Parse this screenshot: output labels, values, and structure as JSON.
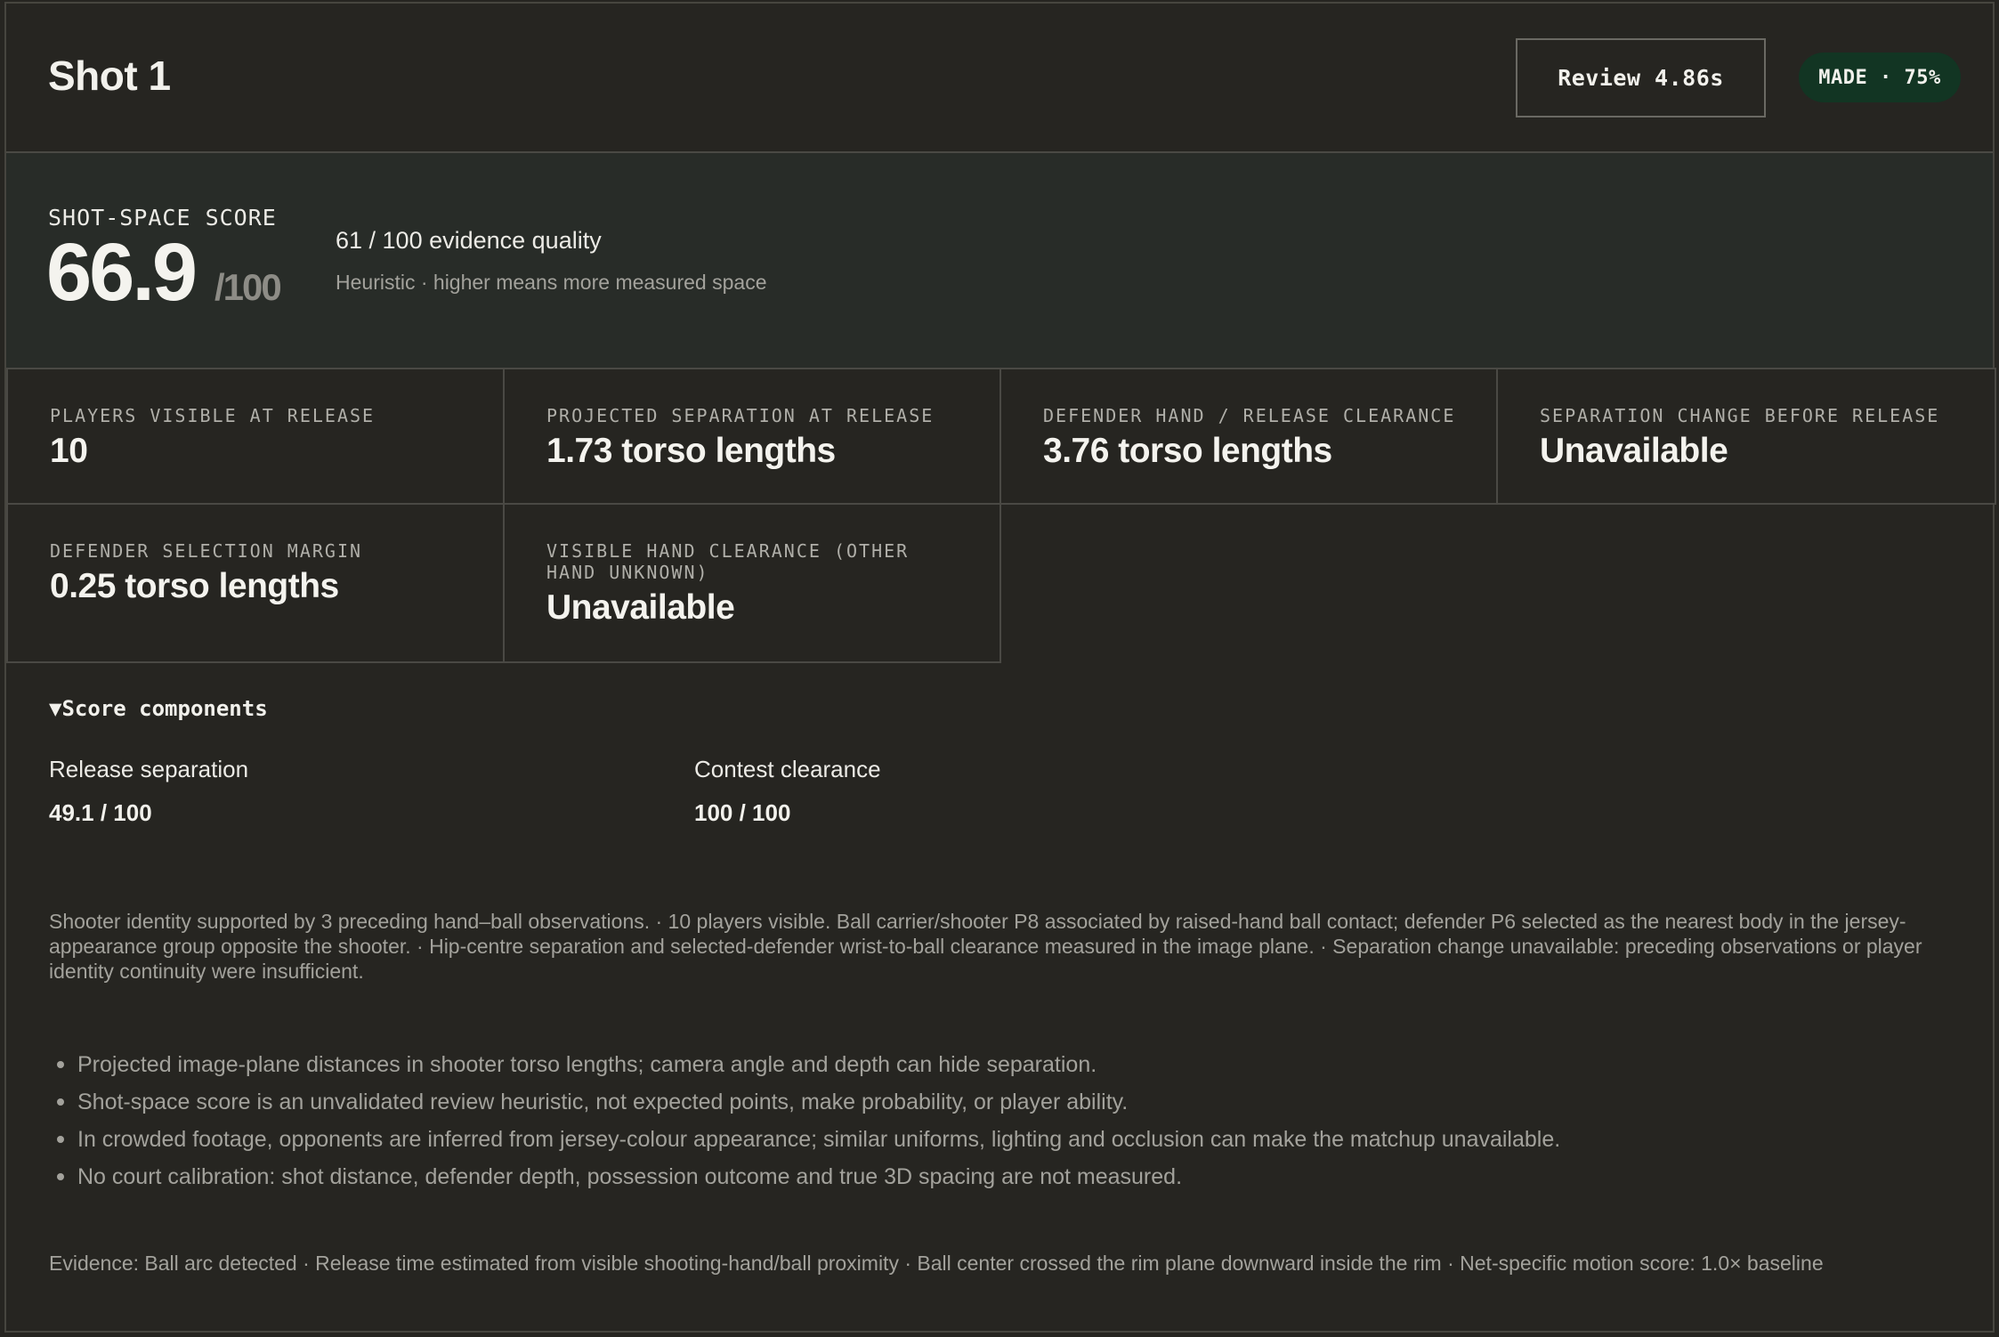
{
  "header": {
    "title": "Shot 1",
    "review_label": "Review 4.86s",
    "status_badge": "MADE · 75%"
  },
  "score": {
    "label": "SHOT-SPACE SCORE",
    "value": "66.9",
    "max": "/100",
    "evidence_quality": "61 / 100 evidence quality",
    "note": "Heuristic · higher means more measured space"
  },
  "metrics": [
    {
      "label": "PLAYERS VISIBLE AT RELEASE",
      "value": "10"
    },
    {
      "label": "PROJECTED SEPARATION AT RELEASE",
      "value": "1.73 torso lengths"
    },
    {
      "label": "DEFENDER HAND / RELEASE CLEARANCE",
      "value": "3.76 torso lengths"
    },
    {
      "label": "SEPARATION CHANGE BEFORE RELEASE",
      "value": "Unavailable"
    },
    {
      "label": "DEFENDER SELECTION MARGIN",
      "value": "0.25 torso lengths"
    },
    {
      "label": "VISIBLE HAND CLEARANCE (OTHER HAND UNKNOWN)",
      "value": "Unavailable"
    }
  ],
  "components": {
    "toggle_label": "▼Score components",
    "items": [
      {
        "name": "Release separation",
        "value": "49.1 / 100"
      },
      {
        "name": "Contest clearance",
        "value": "100 / 100"
      }
    ]
  },
  "summary": "Shooter identity supported by 3 preceding hand–ball observations. · 10 players visible. Ball carrier/shooter P8 associated by raised-hand ball contact; defender P6 selected as the nearest body in the jersey-appearance group opposite the shooter. · Hip-centre separation and selected-defender wrist-to-ball clearance measured in the image plane. · Separation change unavailable: preceding observations or player identity continuity were insufficient.",
  "caveats": [
    "Projected image-plane distances in shooter torso lengths; camera angle and depth can hide separation.",
    "Shot-space score is an unvalidated review heuristic, not expected points, make probability, or player ability.",
    "In crowded footage, opponents are inferred from jersey-colour appearance; similar uniforms, lighting and occlusion can make the matchup unavailable.",
    "No court calibration: shot distance, defender depth, possession outcome and true 3D spacing are not measured."
  ],
  "evidence": "Evidence: Ball arc detected · Release time estimated from visible shooting-hand/ball proximity · Ball center crossed the rim plane downward inside the rim · Net-specific motion score: 1.0× baseline"
}
